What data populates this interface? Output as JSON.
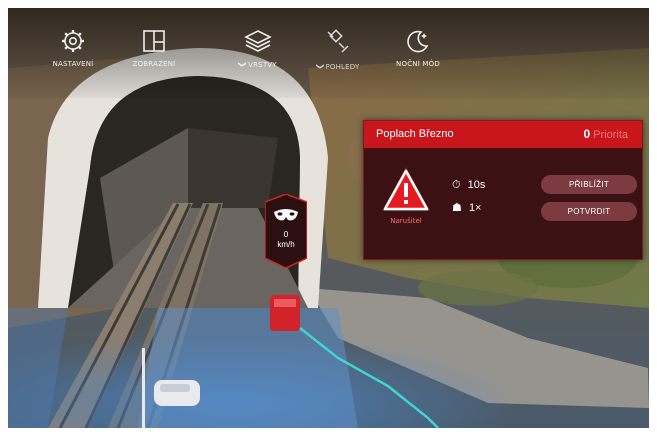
{
  "toolbar": {
    "items": [
      {
        "label": "NASTAVENÍ",
        "icon": "gear-icon"
      },
      {
        "label": "ZOBRAZENÍ",
        "icon": "layout-panels-icon"
      },
      {
        "label": "VRSTVY",
        "icon": "layers-icon",
        "chevron": "❯"
      },
      {
        "label": "POHLEDY",
        "icon": "satellite-view-icon",
        "chevron": "❯"
      },
      {
        "label": "NOČNÍ MÓD",
        "icon": "moon-icon"
      }
    ]
  },
  "alarm": {
    "title": "Poplach Březno",
    "priority_value": "0",
    "priority_label": "Priorita",
    "type_label": "Narušitel",
    "duration": "10s",
    "count": "1×",
    "zoom_button": "PŘIBLÍŽIT",
    "confirm_button": "POTVRDIT"
  },
  "marker": {
    "speed_value": "0",
    "speed_unit": "km/h",
    "icon": "mask-icon"
  },
  "colors": {
    "alarm_red": "#c8161c",
    "panel_bg": "#3b1114",
    "button_bg": "#7c3b40",
    "track_cyan": "#3fd6d0"
  }
}
